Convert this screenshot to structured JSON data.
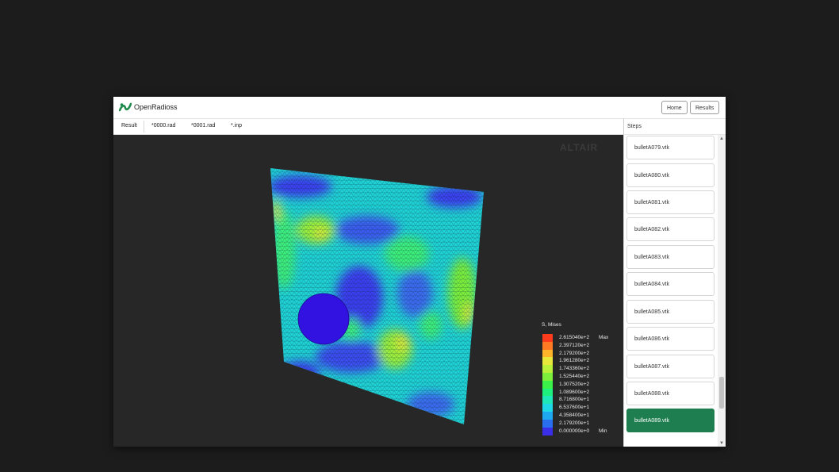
{
  "app": {
    "title": "OpenRadioss"
  },
  "nav": {
    "home_label": "Home",
    "results_label": "Results"
  },
  "tabs": [
    {
      "label": "Result"
    },
    {
      "label": "*0000.rad"
    },
    {
      "label": "*0001.rad"
    },
    {
      "label": "*.inp"
    }
  ],
  "viewport": {
    "watermark": "ALTAIR"
  },
  "legend": {
    "title": "S, Mises",
    "max_tag": "Max",
    "min_tag": "Min",
    "entries": [
      {
        "value": "2.615040e+2",
        "color": "#ff3b1e"
      },
      {
        "value": "2.397120e+2",
        "color": "#ff7a22"
      },
      {
        "value": "2.179200e+2",
        "color": "#ffb42a"
      },
      {
        "value": "1.961280e+2",
        "color": "#e8e83a"
      },
      {
        "value": "1.743360e+2",
        "color": "#b8f03a"
      },
      {
        "value": "1.525440e+2",
        "color": "#7cf03a"
      },
      {
        "value": "1.307520e+2",
        "color": "#3cf04a"
      },
      {
        "value": "1.089600e+2",
        "color": "#1ef07e"
      },
      {
        "value": "8.716800e+1",
        "color": "#1ee8b8"
      },
      {
        "value": "6.537600e+1",
        "color": "#1ed8e8"
      },
      {
        "value": "4.358400e+1",
        "color": "#1ea8f0"
      },
      {
        "value": "2.179200e+1",
        "color": "#2a6ef0"
      },
      {
        "value": "0.000000e+0",
        "color": "#3a2ee8"
      }
    ]
  },
  "steps": {
    "title": "Steps",
    "items": [
      {
        "label": "bulletA079.vtk"
      },
      {
        "label": "bulletA080.vtk"
      },
      {
        "label": "bulletA081.vtk"
      },
      {
        "label": "bulletA082.vtk"
      },
      {
        "label": "bulletA083.vtk"
      },
      {
        "label": "bulletA084.vtk"
      },
      {
        "label": "bulletA085.vtk"
      },
      {
        "label": "bulletA086.vtk"
      },
      {
        "label": "bulletA087.vtk"
      },
      {
        "label": "bulletA088.vtk"
      },
      {
        "label": "bulletA089.vtk"
      }
    ],
    "selected": "bulletA089.vtk"
  },
  "colors": {
    "accent": "#1e7e4f",
    "logo": "#1e8a4c"
  }
}
